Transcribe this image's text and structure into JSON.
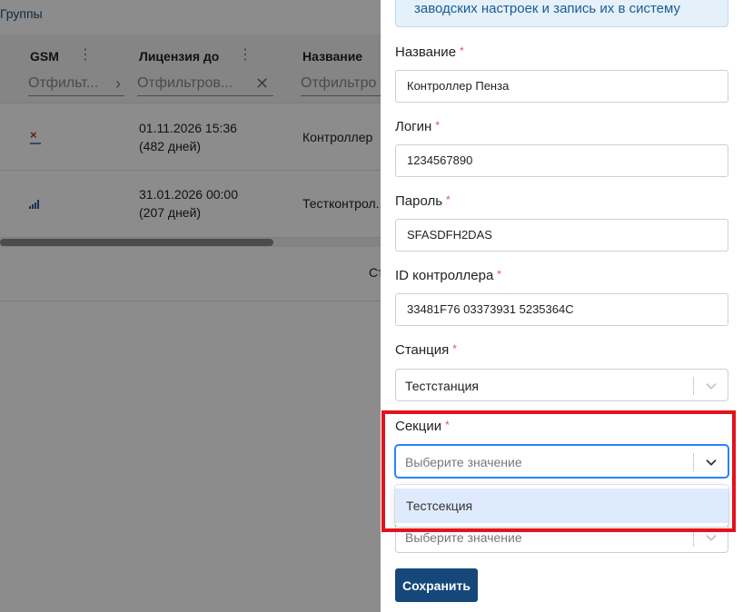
{
  "background": {
    "groups_link": "Группы",
    "columns": [
      {
        "title": "GSM",
        "filter": "Отфильт..."
      },
      {
        "title": "Лицензия до",
        "filter": "Отфильтров..."
      },
      {
        "title": "Название",
        "filter": "Отфильтро"
      }
    ],
    "rows": [
      {
        "gsm_icon": "no-signal-icon",
        "license_date": "01.11.2026 15:36",
        "license_days": "(482 дней)",
        "name": "Контроллер"
      },
      {
        "gsm_icon": "signal-strength-icon",
        "license_date": "31.01.2026 00:00",
        "license_days": "(207 дней)",
        "name": "Тестконтрол..."
      }
    ],
    "pager_text": "Ст"
  },
  "form": {
    "info_text": "заводских настроек и запись их в систему",
    "name_label": "Название",
    "name_value": "Контроллер Пенза",
    "login_label": "Логин",
    "login_value": "1234567890",
    "password_label": "Пароль",
    "password_value": "SFASDFH2DAS",
    "controller_id_label": "ID контроллера",
    "controller_id_value": "33481F76 03373931 5235364C",
    "station_label": "Станция",
    "station_value": "Тестстанция",
    "sections_label": "Секции",
    "sections_placeholder": "Выберите значение",
    "sections_options": [
      "Тестсекция"
    ],
    "next_select_placeholder": "Выберите значение",
    "required_mark": "*",
    "save_label": "Сохранить"
  },
  "colors": {
    "primary": "#16477a",
    "focus": "#2684ff",
    "highlight": "#e3121d",
    "required": "#e05252",
    "option_hover": "#deebff"
  }
}
